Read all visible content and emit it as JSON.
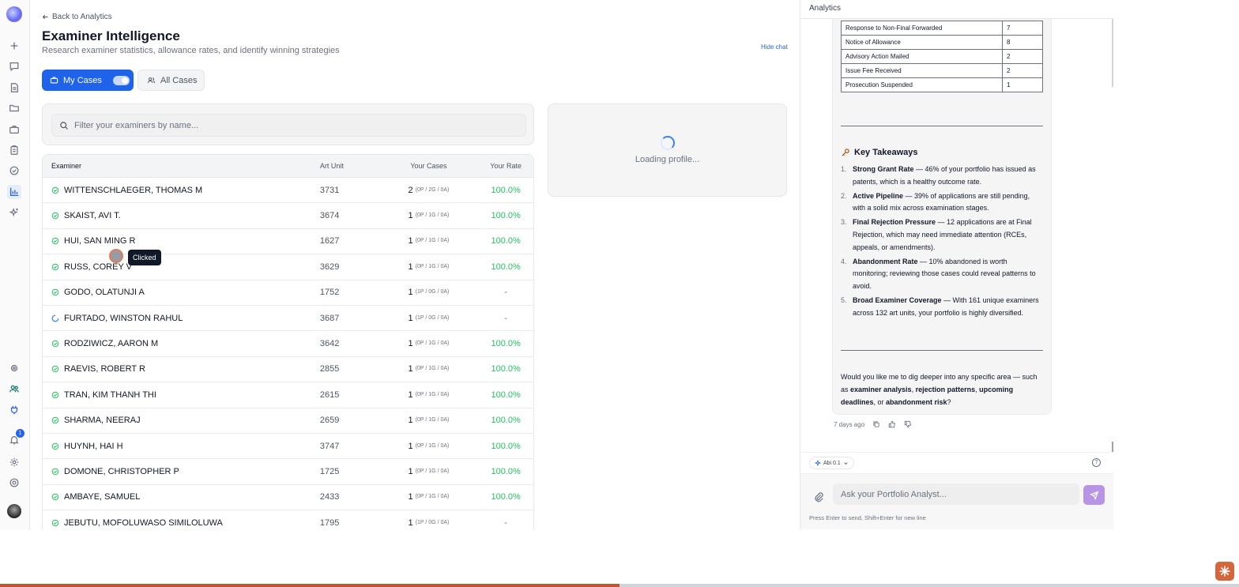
{
  "colors": {
    "accent": "#1e63e9",
    "success": "#22c55e",
    "send": "#b794e6",
    "progress": "#c2562f"
  },
  "nav": {
    "back_label": "Back to Analytics",
    "title": "Examiner Intelligence",
    "subtitle": "Research examiner statistics, allowance rates, and identify winning strategies",
    "hide_chat": "Hide chat"
  },
  "tabs": {
    "my_cases": "My Cases",
    "all_cases": "All Cases"
  },
  "search": {
    "placeholder": "Filter your examiners by name..."
  },
  "profile": {
    "loading": "Loading profile..."
  },
  "table": {
    "headers": {
      "examiner": "Examiner",
      "art_unit": "Art Unit",
      "cases": "Your Cases",
      "rate": "Your Rate"
    },
    "rows": [
      {
        "name": "WITTENSCHLAEGER, THOMAS M",
        "art": "3731",
        "cases": "2",
        "detail": "(0P / 2G / 0A)",
        "rate": "100.0%",
        "status": "done"
      },
      {
        "name": "SKAIST, AVI T.",
        "art": "3674",
        "cases": "1",
        "detail": "(0P / 1G / 0A)",
        "rate": "100.0%",
        "status": "done"
      },
      {
        "name": "HUI, SAN MING R",
        "art": "1627",
        "cases": "1",
        "detail": "(0P / 1G / 0A)",
        "rate": "100.0%",
        "status": "done"
      },
      {
        "name": "RUSS, COREY V",
        "art": "3629",
        "cases": "1",
        "detail": "(0P / 1G / 0A)",
        "rate": "100.0%",
        "status": "done"
      },
      {
        "name": "GODO, OLATUNJI A",
        "art": "1752",
        "cases": "1",
        "detail": "(1P / 0G / 0A)",
        "rate": "-",
        "status": "done"
      },
      {
        "name": "FURTADO, WINSTON RAHUL",
        "art": "3687",
        "cases": "1",
        "detail": "(1P / 0G / 0A)",
        "rate": "-",
        "status": "loading"
      },
      {
        "name": "RODZIWICZ, AARON M",
        "art": "3642",
        "cases": "1",
        "detail": "(0P / 1G / 0A)",
        "rate": "100.0%",
        "status": "done"
      },
      {
        "name": "RAEVIS, ROBERT R",
        "art": "2855",
        "cases": "1",
        "detail": "(0P / 1G / 0A)",
        "rate": "100.0%",
        "status": "done"
      },
      {
        "name": "TRAN, KIM THANH THI",
        "art": "2615",
        "cases": "1",
        "detail": "(0P / 1G / 0A)",
        "rate": "100.0%",
        "status": "done"
      },
      {
        "name": "SHARMA, NEERAJ",
        "art": "2659",
        "cases": "1",
        "detail": "(0P / 1G / 0A)",
        "rate": "100.0%",
        "status": "done"
      },
      {
        "name": "HUYNH, HAI H",
        "art": "3747",
        "cases": "1",
        "detail": "(0P / 1G / 0A)",
        "rate": "100.0%",
        "status": "done"
      },
      {
        "name": "DOMONE, CHRISTOPHER P",
        "art": "1725",
        "cases": "1",
        "detail": "(0P / 1G / 0A)",
        "rate": "100.0%",
        "status": "done"
      },
      {
        "name": "AMBAYE, SAMUEL",
        "art": "2433",
        "cases": "1",
        "detail": "(0P / 1G / 0A)",
        "rate": "100.0%",
        "status": "done"
      },
      {
        "name": "JEBUTU, MOFOLUWASO SIMILOLUWA",
        "art": "1795",
        "cases": "1",
        "detail": "(1P / 0G / 0A)",
        "rate": "-",
        "status": "done"
      }
    ]
  },
  "overlay": {
    "clicked": "Clicked"
  },
  "chat": {
    "header": "Analytics",
    "status_table": [
      {
        "label": "Response to Non-Final Forwarded",
        "count": "7"
      },
      {
        "label": "Notice of Allowance",
        "count": "8"
      },
      {
        "label": "Advisory Action Mailed",
        "count": "2"
      },
      {
        "label": "Issue Fee Received",
        "count": "2"
      },
      {
        "label": "Prosecution Suspended",
        "count": "1"
      }
    ],
    "takeaways_title": "Key Takeaways",
    "takeaways": [
      {
        "num": "1.",
        "bold": "Strong Grant Rate",
        "text": " — 46% of your portfolio has issued as patents, which is a healthy outcome rate."
      },
      {
        "num": "2.",
        "bold": "Active Pipeline",
        "text": " — 39% of applications are still pending, with a solid mix across examination stages."
      },
      {
        "num": "3.",
        "bold": "Final Rejection Pressure",
        "text": " — 12 applications are at Final Rejection, which may need immediate attention (RCEs, appeals, or amendments)."
      },
      {
        "num": "4.",
        "bold": "Abandonment Rate",
        "text": " — 10% abandoned is worth monitoring; reviewing those cases could reveal patterns to avoid."
      },
      {
        "num": "5.",
        "bold": "Broad Examiner Coverage",
        "text": " — With 161 unique examiners across 132 art units, your portfolio is highly diversified."
      }
    ],
    "closing": {
      "pre": "Would you like me to dig deeper into any specific area — such as ",
      "b1": "examiner analysis",
      "s1": ", ",
      "b2": "rejection patterns",
      "s2": ", ",
      "b3": "upcoming deadlines",
      "s3": ", or ",
      "b4": "abandonment risk",
      "post": "?"
    },
    "timestamp": "7 days ago",
    "model": "Abi 0.1",
    "input_placeholder": "Ask your Portfolio Analyst...",
    "hint": "Press Enter to send, Shift+Enter for new line",
    "notification_count": "1"
  },
  "progress": {
    "fraction": 0.5
  }
}
